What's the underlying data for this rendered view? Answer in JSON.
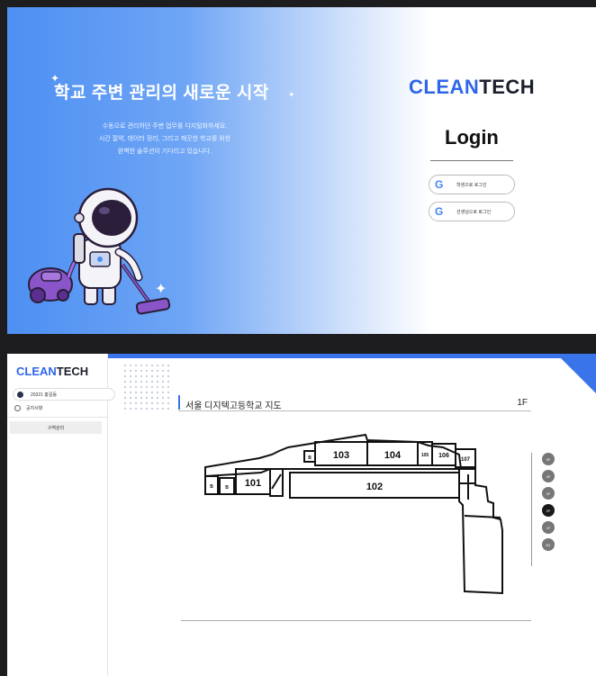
{
  "login": {
    "hero_title": "학교 주변 관리의 새로운 시작",
    "hero_desc": [
      "수동으로 관리하던 주변 업무를 디지털화하세요.",
      "시간 절약, 데이터 정리, 그리고 깨끗한 학교를 위한",
      "완벽한 솔루션이 기다리고 있습니다."
    ],
    "brand_clean": "CLEAN",
    "brand_tech": "TECH",
    "title": "Login",
    "buttons": [
      {
        "label": "학생으로 로그인",
        "icon": "google-icon"
      },
      {
        "label": "선생님으로 로그인",
        "icon": "google-icon"
      }
    ]
  },
  "map_page": {
    "sidebar": {
      "brand_clean": "CLEAN",
      "brand_tech": "TECH",
      "user": "20321 홍길동",
      "notice": "공지사항",
      "menu_button": "구역관리"
    },
    "map_title": "서울 디지텍고등학교 지도",
    "current_floor": "1F",
    "rooms": {
      "r101": "101",
      "r102": "102",
      "r103": "103",
      "r104": "104",
      "r105": "105",
      "r106": "106",
      "r107": "107"
    },
    "floors": [
      "5F",
      "4F",
      "3F",
      "2F",
      "1F",
      "B1"
    ],
    "active_floor_index": 3
  },
  "colors": {
    "accent": "#3a74ea",
    "brand_blue": "#2f66e8",
    "brand_dark": "#1b1f2c"
  }
}
